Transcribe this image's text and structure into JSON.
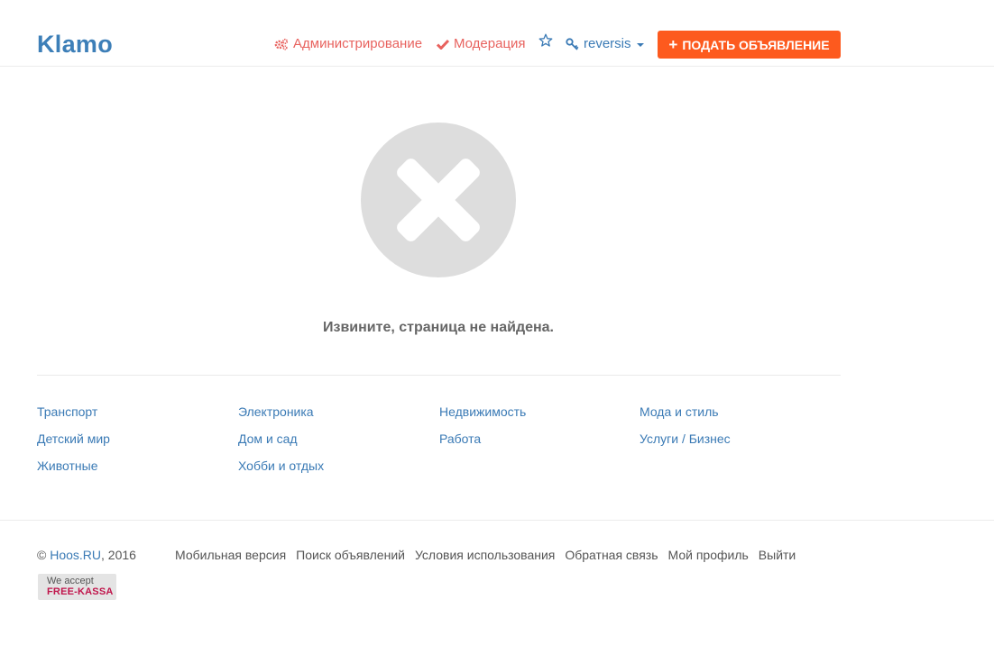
{
  "header": {
    "logo": "Klamo",
    "nav": {
      "admin_label": "Администрирование",
      "moderation_label": "Модерация",
      "user_label": "reversis",
      "post_button_label": "ПОДАТЬ ОБЪЯВЛЕНИЕ",
      "post_button_plus": "+"
    }
  },
  "error": {
    "message": "Извините, страница не найдена."
  },
  "categories": [
    "Транспорт",
    "Электроника",
    "Недвижимость",
    "Мода и стиль",
    "Детский мир",
    "Дом и сад",
    "Работа",
    "Услуги / Бизнес",
    "Животные",
    "Хобби и отдых"
  ],
  "footer": {
    "copyright_symbol": "©",
    "site": "Hoos.RU",
    "year": ", 2016",
    "links": [
      "Мобильная версия",
      "Поиск объявлений",
      "Условия использования",
      "Обратная связь",
      "Мой профиль",
      "Выйти"
    ],
    "badge": {
      "line1": "We accept",
      "line2": "FREE-KASSA"
    }
  },
  "colors": {
    "brand": "#3d7fb8",
    "link": "#3a7ab5",
    "admin_red": "#e8625e",
    "cta_orange": "#fd5a1e",
    "error_icon": "#dddddd"
  }
}
